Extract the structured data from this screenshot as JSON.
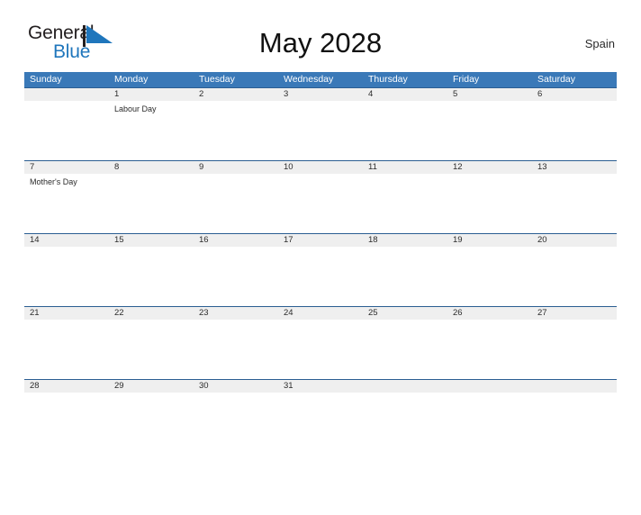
{
  "brand": {
    "name_part1": "General",
    "name_part2": "Blue",
    "accent_color": "#1f76bc",
    "flag_icon": "triangle-flag-icon"
  },
  "header": {
    "title": "May 2028",
    "region": "Spain"
  },
  "calendar": {
    "month": "May",
    "year": "2028",
    "header_bg": "#3a79b8",
    "date_band_bg": "#efefef",
    "weekdays": [
      "Sunday",
      "Monday",
      "Tuesday",
      "Wednesday",
      "Thursday",
      "Friday",
      "Saturday"
    ],
    "weeks": [
      {
        "days": [
          {
            "date": "",
            "events": []
          },
          {
            "date": "1",
            "events": [
              "Labour Day"
            ]
          },
          {
            "date": "2",
            "events": []
          },
          {
            "date": "3",
            "events": []
          },
          {
            "date": "4",
            "events": []
          },
          {
            "date": "5",
            "events": []
          },
          {
            "date": "6",
            "events": []
          }
        ]
      },
      {
        "days": [
          {
            "date": "7",
            "events": [
              "Mother's Day"
            ]
          },
          {
            "date": "8",
            "events": []
          },
          {
            "date": "9",
            "events": []
          },
          {
            "date": "10",
            "events": []
          },
          {
            "date": "11",
            "events": []
          },
          {
            "date": "12",
            "events": []
          },
          {
            "date": "13",
            "events": []
          }
        ]
      },
      {
        "days": [
          {
            "date": "14",
            "events": []
          },
          {
            "date": "15",
            "events": []
          },
          {
            "date": "16",
            "events": []
          },
          {
            "date": "17",
            "events": []
          },
          {
            "date": "18",
            "events": []
          },
          {
            "date": "19",
            "events": []
          },
          {
            "date": "20",
            "events": []
          }
        ]
      },
      {
        "days": [
          {
            "date": "21",
            "events": []
          },
          {
            "date": "22",
            "events": []
          },
          {
            "date": "23",
            "events": []
          },
          {
            "date": "24",
            "events": []
          },
          {
            "date": "25",
            "events": []
          },
          {
            "date": "26",
            "events": []
          },
          {
            "date": "27",
            "events": []
          }
        ]
      },
      {
        "days": [
          {
            "date": "28",
            "events": []
          },
          {
            "date": "29",
            "events": []
          },
          {
            "date": "30",
            "events": []
          },
          {
            "date": "31",
            "events": []
          },
          {
            "date": "",
            "events": []
          },
          {
            "date": "",
            "events": []
          },
          {
            "date": "",
            "events": []
          }
        ]
      }
    ]
  }
}
